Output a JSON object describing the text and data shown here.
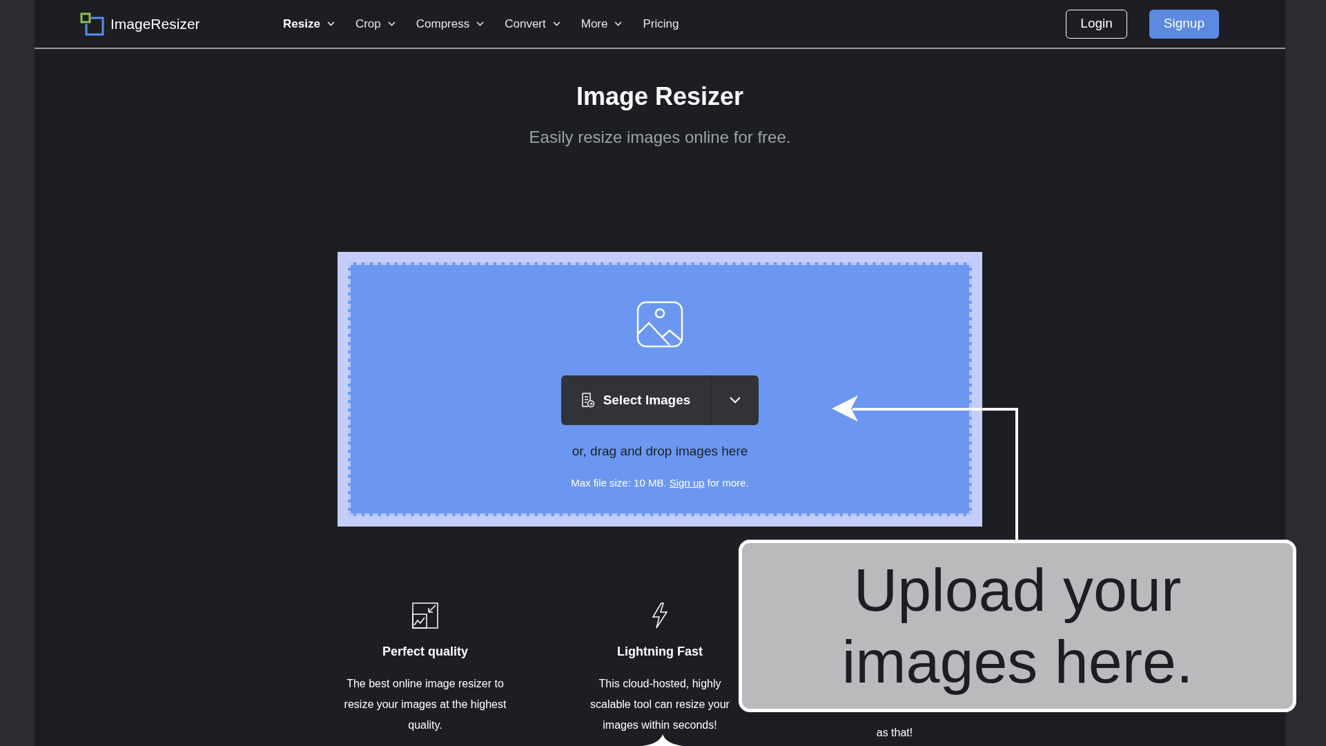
{
  "header": {
    "logo": "ImageResizer",
    "nav": [
      {
        "label": "Resize",
        "selected": true,
        "dropdown": true
      },
      {
        "label": "Crop",
        "selected": false,
        "dropdown": true
      },
      {
        "label": "Compress",
        "selected": false,
        "dropdown": true
      },
      {
        "label": "Convert",
        "selected": false,
        "dropdown": true
      },
      {
        "label": "More",
        "selected": false,
        "dropdown": true
      },
      {
        "label": "Pricing",
        "selected": false,
        "dropdown": false
      }
    ],
    "login": "Login",
    "signup": "Signup"
  },
  "hero": {
    "title": "Image Resizer",
    "subtitle": "Easily resize images online for free."
  },
  "upload": {
    "button": "Select Images",
    "drop_text": "or, drag and drop images here",
    "limit_text": "Max file size: 10 MB.",
    "limit_link": "Sign up",
    "limit_suffix": "for more."
  },
  "features": [
    {
      "kind": "quality",
      "title": "Perfect quality",
      "text": "The best online image resizer to resize your images at the highest quality."
    },
    {
      "kind": "fast",
      "title": "Lightning Fast",
      "text": "This cloud-hosted, highly scalable tool can resize your images within seconds!"
    },
    {
      "kind": "covered",
      "text": "as that!"
    }
  ],
  "callout": {
    "text": "Upload your images here."
  }
}
